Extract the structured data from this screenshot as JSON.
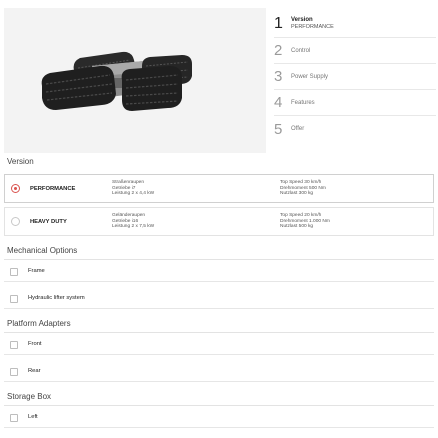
{
  "product_image": {
    "alt": "tracked-vehicle-image"
  },
  "steps": [
    {
      "number": "1",
      "label": "Version",
      "sub": "PERFORMANCE",
      "active": true
    },
    {
      "number": "2",
      "label": "Control"
    },
    {
      "number": "3",
      "label": "Power Supply"
    },
    {
      "number": "4",
      "label": "Features"
    },
    {
      "number": "5",
      "label": "Offer"
    }
  ],
  "version": {
    "title": "Version",
    "options": [
      {
        "name": "PERFORMANCE",
        "selected": true,
        "specs_left": [
          "Straßenraupen",
          "Getriebe i7",
          "Leistung 2 x 4,4 kW"
        ],
        "specs_right": [
          "Top Speed 30 km/h",
          "Drehmoment 500 Nm",
          "Nutzlast 300 kg"
        ]
      },
      {
        "name": "HEAVY DUTY",
        "selected": false,
        "specs_left": [
          "Geländeraupen",
          "Getriebe i16",
          "Leistung 2 x 7,5 kW"
        ],
        "specs_right": [
          "Top Speed 20 km/h",
          "Drehmoment 1.000 Nm",
          "Nutzlast 500 kg"
        ]
      }
    ]
  },
  "mechanical": {
    "title": "Mechanical Options",
    "items": [
      "Frame",
      "Hydraulic lifter system"
    ]
  },
  "platform": {
    "title": "Platform Adapters",
    "items": [
      "Front",
      "Rear"
    ]
  },
  "storage": {
    "title": "Storage Box",
    "items": [
      "Left"
    ]
  },
  "colors": {
    "accent": "#d9534f",
    "border": "#e3e3e3",
    "hero_bg": "#f3f3f3"
  }
}
